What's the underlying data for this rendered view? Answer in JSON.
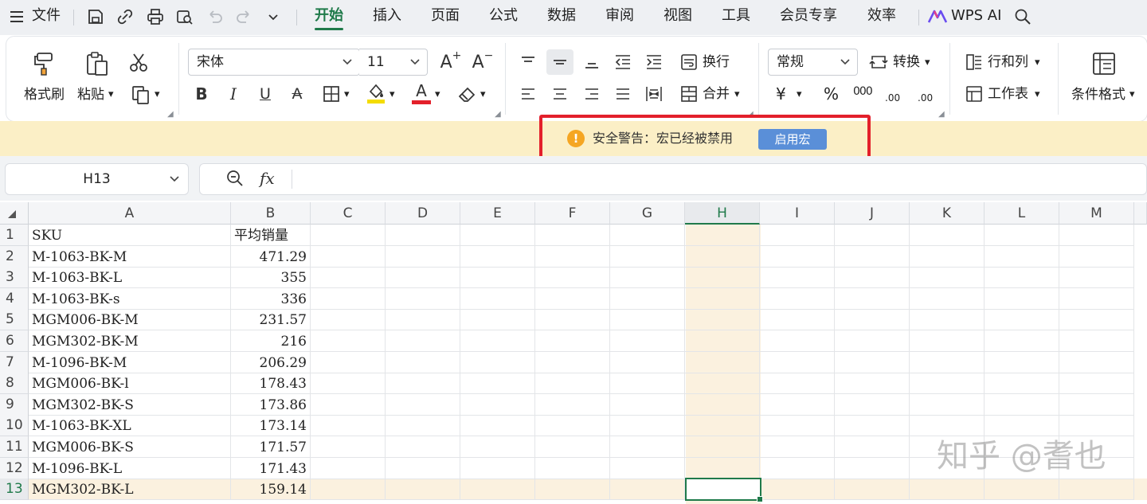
{
  "menubar": {
    "file_label": "文件",
    "tabs": [
      "开始",
      "插入",
      "页面",
      "公式",
      "数据",
      "审阅",
      "视图",
      "工具",
      "会员专享",
      "效率"
    ],
    "active_tab": "开始",
    "wps_ai_label": "WPS AI"
  },
  "ribbon": {
    "format_painter": "格式刷",
    "paste": "粘贴",
    "font_name": "宋体",
    "font_size": "11",
    "wrap_text": "换行",
    "merge": "合并",
    "number_format": "常规",
    "convert": "转换",
    "rows_cols": "行和列",
    "worksheet": "工作表",
    "cond_format": "条件格式",
    "currency_symbol": "¥",
    "percent_symbol": "%",
    "thousands_symbol": "000",
    "dec_inc": ".00",
    "dec_dec": ".00",
    "caret": "▾",
    "font_grow": "A",
    "font_shrink": "A",
    "font_color_letter": "A"
  },
  "security": {
    "icon_text": "!",
    "message": "安全警告：宏已经被禁用",
    "enable_button": "启用宏"
  },
  "formula_bar": {
    "name_box": "H13",
    "fx_label": "fx",
    "content": ""
  },
  "sheet": {
    "columns": [
      "A",
      "B",
      "C",
      "D",
      "E",
      "F",
      "G",
      "H",
      "I",
      "J",
      "K",
      "L",
      "M"
    ],
    "selected_column": "H",
    "selected_row": "13",
    "rows": [
      {
        "n": "1",
        "a": "SKU",
        "b": "平均销量"
      },
      {
        "n": "2",
        "a": "M-1063-BK-M",
        "b": "471.29"
      },
      {
        "n": "3",
        "a": "M-1063-BK-L",
        "b": "355"
      },
      {
        "n": "4",
        "a": "M-1063-BK-s",
        "b": "336"
      },
      {
        "n": "5",
        "a": "MGM006-BK-M",
        "b": "231.57"
      },
      {
        "n": "6",
        "a": "MGM302-BK-M",
        "b": "216"
      },
      {
        "n": "7",
        "a": "M-1096-BK-M",
        "b": "206.29"
      },
      {
        "n": "8",
        "a": "MGM006-BK-l",
        "b": "178.43"
      },
      {
        "n": "9",
        "a": "MGM302-BK-S",
        "b": "173.86"
      },
      {
        "n": "10",
        "a": "M-1063-BK-XL",
        "b": "173.14"
      },
      {
        "n": "11",
        "a": "MGM006-BK-S",
        "b": "171.57"
      },
      {
        "n": "12",
        "a": "M-1096-BK-L",
        "b": "171.43"
      },
      {
        "n": "13",
        "a": "MGM302-BK-L",
        "b": "159.14"
      }
    ]
  },
  "watermark": "知乎 @耆也",
  "colors": {
    "accent": "#1f7a4a",
    "warning_bar": "#fbefc6",
    "highlight_box": "#e3202b",
    "enable_button": "#5a8fd8"
  }
}
